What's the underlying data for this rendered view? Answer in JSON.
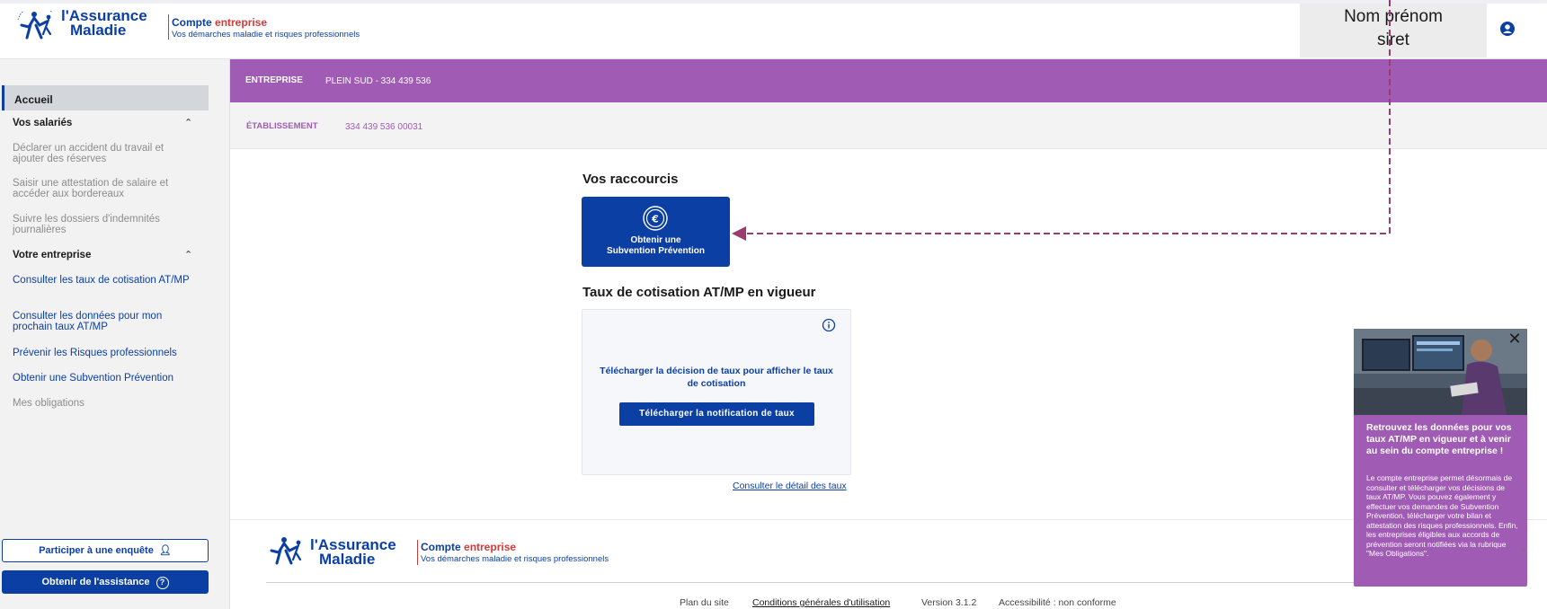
{
  "header": {
    "logo_line1": "l'Assurance",
    "logo_line2": "Maladie",
    "compte": "Compte",
    "entreprise": "entreprise",
    "subtitle": "Vos démarches maladie et risques professionnels",
    "user_name": "Nom prénom",
    "user_siret": "siret"
  },
  "sidebar": {
    "accueil": "Accueil",
    "section_salaries": "Vos salariés",
    "salaries_items": [
      "Déclarer un accident du travail et ajouter des réserves",
      "Saisir une attestation de salaire et accéder aux bordereaux",
      "Suivre les dossiers d'indemnités journalières"
    ],
    "section_entreprise": "Votre entreprise",
    "entreprise_items": [
      "Consulter les taux de cotisation AT/MP",
      "Consulter les données pour mon prochain taux AT/MP",
      "Prévenir les Risques professionnels",
      "Obtenir une Subvention Prévention",
      "Mes obligations"
    ],
    "btn_enquete": "Participer à une enquête",
    "btn_assistance": "Obtenir de l'assistance"
  },
  "entreprise_bar": {
    "label": "ENTREPRISE",
    "value": "PLEIN SUD - 334 439 536"
  },
  "etablissement_bar": {
    "label": "ÉTABLISSEMENT",
    "value": "334 439 536 00031"
  },
  "main": {
    "raccourcis_title": "Vos raccourcis",
    "shortcut_line1": "Obtenir une",
    "shortcut_line2": "Subvention Prévention",
    "taux_title": "Taux de cotisation AT/MP en vigueur",
    "taux_text": "Télécharger la décision de taux pour afficher le taux de cotisation",
    "btn_notification": "Télécharger la notification de taux",
    "link_detail": "Consulter le détail des taux"
  },
  "footer": {
    "plan": "Plan du site",
    "cgu": "Conditions générales d'utilisation",
    "version": "Version 3.1.2",
    "accessibilite": "Accessibilité : non conforme"
  },
  "popup": {
    "title": "Retrouvez les données pour vos taux AT/MP en vigueur et à venir au sein du compte entreprise !",
    "body": "Le compte entreprise permet désormais de consulter et télécharger vos décisions de taux AT/MP. Vous pouvez également y effectuer vos demandes de Subvention Prévention, télécharger votre bilan et attestation des risques professionnels. Enfin, les entreprises éligibles aux accords de prévention seront notifiées via la rubrique \"Mes Obligations\"."
  },
  "colors": {
    "brand_blue": "#0b3fa3",
    "purple": "#a05bb4",
    "annotation": "#9b3b6f"
  }
}
